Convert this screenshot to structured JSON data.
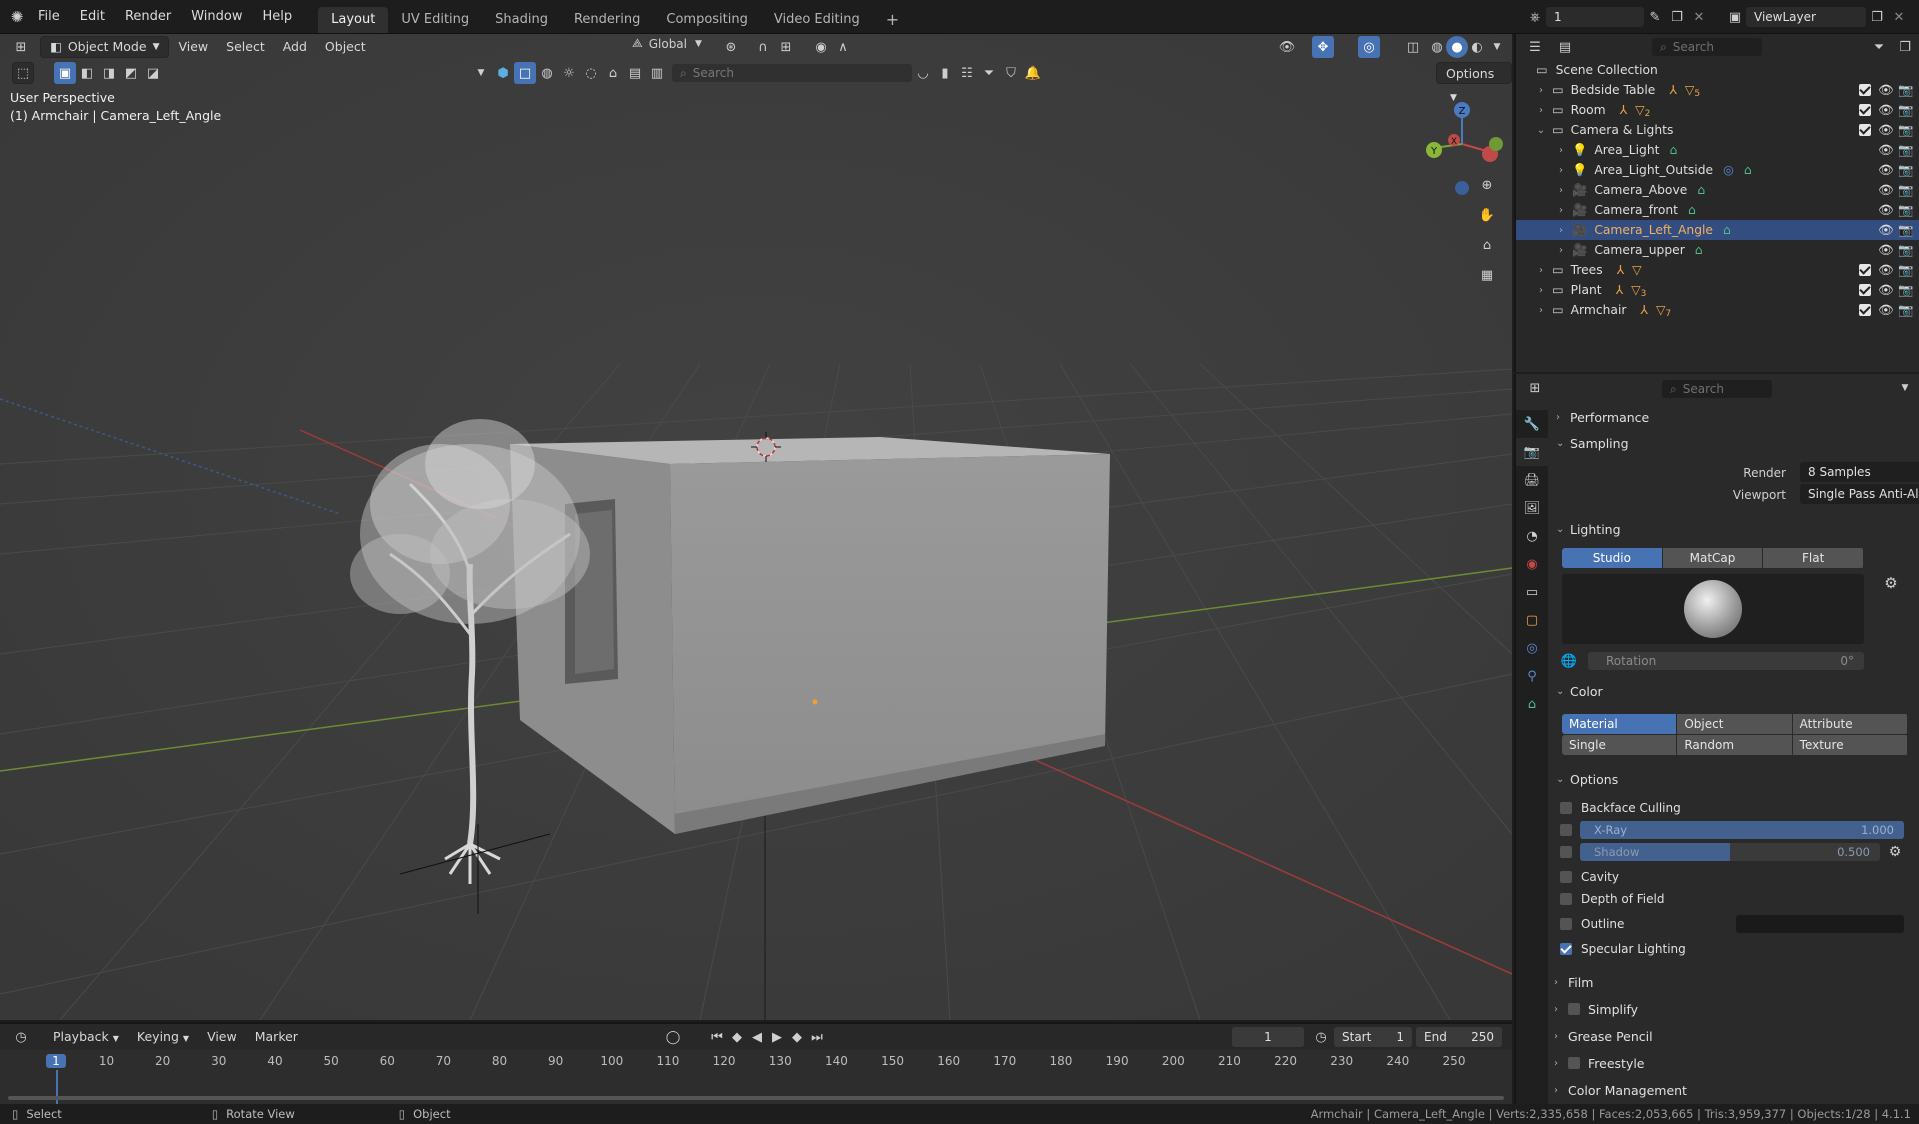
{
  "menu": {
    "items": [
      "File",
      "Edit",
      "Render",
      "Window",
      "Help"
    ],
    "workspaces": [
      "Layout",
      "UV Editing",
      "Shading",
      "Rendering",
      "Compositing",
      "Video Editing"
    ],
    "active_workspace": "Layout",
    "scene_frame": "1",
    "view_layer": "ViewLayer"
  },
  "viewport": {
    "mode": "Object Mode",
    "menus": [
      "View",
      "Select",
      "Add",
      "Object"
    ],
    "transform_orientation": "Global",
    "search_placeholder": "Search",
    "options_label": "Options",
    "overlay_line1": "User Perspective",
    "overlay_line2": "(1) Armchair | Camera_Left_Angle",
    "axis_labels": {
      "z": "Z",
      "y": "Y",
      "x": "X"
    }
  },
  "outliner": {
    "search_placeholder": "Search",
    "root": "Scene Collection",
    "rows": [
      {
        "label": "Bedside Table",
        "level": 0,
        "badge": "5",
        "icon": "collection-icon"
      },
      {
        "label": "Room",
        "level": 0,
        "badge": "2",
        "icon": "collection-icon"
      },
      {
        "label": "Camera & Lights",
        "level": 0,
        "badge": "",
        "icon": "collection-icon"
      },
      {
        "label": "Area_Light",
        "level": 1,
        "badge": "",
        "icon": "light-icon"
      },
      {
        "label": "Area_Light_Outside",
        "level": 1,
        "badge": "",
        "icon": "light-icon"
      },
      {
        "label": "Camera_Above",
        "level": 1,
        "badge": "",
        "icon": "camera-icon"
      },
      {
        "label": "Camera_front",
        "level": 1,
        "badge": "",
        "icon": "camera-icon"
      },
      {
        "label": "Camera_Left_Angle",
        "level": 1,
        "badge": "",
        "icon": "camera-icon",
        "selected": true
      },
      {
        "label": "Camera_upper",
        "level": 1,
        "badge": "",
        "icon": "camera-icon"
      },
      {
        "label": "Trees",
        "level": 0,
        "badge": "",
        "icon": "collection-icon"
      },
      {
        "label": "Plant",
        "level": 0,
        "badge": "3",
        "icon": "collection-icon"
      },
      {
        "label": "Armchair",
        "level": 0,
        "badge": "7",
        "icon": "collection-icon"
      }
    ]
  },
  "properties": {
    "search_placeholder": "Search",
    "performance": "Performance",
    "sampling": {
      "title": "Sampling",
      "render_label": "Render",
      "render_value": "8 Samples",
      "viewport_label": "Viewport",
      "viewport_value": "Single Pass Anti-Aliasing"
    },
    "lighting": {
      "title": "Lighting",
      "modes": [
        "Studio",
        "MatCap",
        "Flat"
      ],
      "active": "Studio",
      "rotation_label": "Rotation",
      "rotation_value": "0°"
    },
    "color": {
      "title": "Color",
      "row1": [
        "Material",
        "Object",
        "Attribute"
      ],
      "row2": [
        "Single",
        "Random",
        "Texture"
      ],
      "active": "Material"
    },
    "options": {
      "title": "Options",
      "backface": "Backface Culling",
      "xray_label": "X-Ray",
      "xray_value": "1.000",
      "xray_fill": 1.0,
      "shadow_label": "Shadow",
      "shadow_value": "0.500",
      "shadow_fill": 0.5,
      "cavity": "Cavity",
      "dof": "Depth of Field",
      "outline": "Outline",
      "specular": "Specular Lighting"
    },
    "film": "Film",
    "simplify": "Simplify",
    "grease_pencil": "Grease Pencil",
    "freestyle": "Freestyle",
    "color_management": "Color Management"
  },
  "timeline": {
    "menus": [
      "Playback",
      "Keying",
      "View",
      "Marker"
    ],
    "current_frame": "1",
    "start_label": "Start",
    "start_value": "1",
    "end_label": "End",
    "end_value": "250",
    "ticks": [
      "1",
      "10",
      "20",
      "30",
      "40",
      "50",
      "60",
      "70",
      "80",
      "90",
      "100",
      "110",
      "120",
      "130",
      "140",
      "150",
      "160",
      "170",
      "180",
      "190",
      "200",
      "210",
      "220",
      "230",
      "240",
      "250"
    ]
  },
  "status": {
    "left1": "Select",
    "left2": "Rotate View",
    "left3": "Object",
    "right": "Armchair | Camera_Left_Angle | Verts:2,335,658 | Faces:2,053,665 | Tris:3,959,377 | Objects:1/28 | 4.1.1"
  },
  "colors": {
    "accent": "#4772b3",
    "viewport_bg": "#3d3d3d",
    "selected_row": "#334d80",
    "collection_orange": "#e8a24a",
    "camera_green": "#4fbf8a"
  }
}
